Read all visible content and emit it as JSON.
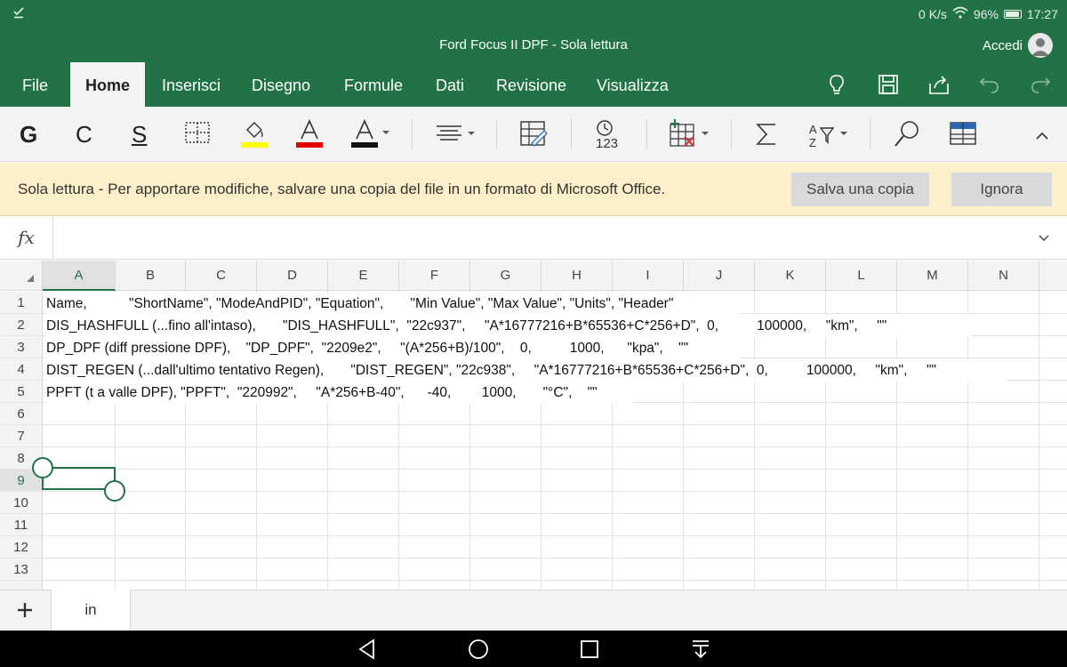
{
  "status_bar": {
    "left_icon": "check-download-icon",
    "network_speed": "0 K/s",
    "battery": "96%",
    "time": "17:27"
  },
  "title_bar": {
    "title": "Ford Focus II DPF - Sola lettura",
    "sign_in": "Accedi"
  },
  "ribbon": {
    "tabs": [
      {
        "label": "File"
      },
      {
        "label": "Home",
        "active": true
      },
      {
        "label": "Inserisci"
      },
      {
        "label": "Disegno"
      },
      {
        "label": "Formule"
      },
      {
        "label": "Dati"
      },
      {
        "label": "Revisione"
      },
      {
        "label": "Visualizza"
      }
    ],
    "tools": {
      "bold": "G",
      "italic": "C",
      "underline": "S",
      "number_format": "123"
    },
    "colors": {
      "accent": "#217346",
      "highlight": "#ffff00",
      "font_color": "#e00000"
    }
  },
  "info_bar": {
    "message": "Sola lettura - Per apportare modifiche, salvare una copia del file in un formato di Microsoft Office.",
    "save_copy": "Salva una copia",
    "ignore": "Ignora"
  },
  "formula_bar": {
    "fx_label": "fx",
    "content": ""
  },
  "sheet": {
    "columns": [
      "A",
      "B",
      "C",
      "D",
      "E",
      "F",
      "G",
      "H",
      "I",
      "J",
      "K",
      "L",
      "M",
      "N"
    ],
    "rows": [
      "1",
      "2",
      "3",
      "4",
      "5",
      "6",
      "7",
      "8",
      "9",
      "10",
      "11",
      "12",
      "13"
    ],
    "cells": [
      "Name,           \"ShortName\", \"ModeAndPID\", \"Equation\",       \"Min Value\", \"Max Value\", \"Units\", \"Header\"",
      "DIS_HASHFULL (...fino all'intaso),       \"DIS_HASHFULL\",  \"22c937\",     \"A*16777216+B*65536+C*256+D\",  0,          100000,     \"km\",     \"\"",
      "DP_DPF (diff pressione DPF),    \"DP_DPF\",  \"2209e2\",     \"(A*256+B)/100\",    0,          1000,      \"kpa\",    \"\"",
      "DIST_REGEN (...dall'ultimo tentativo Regen),       \"DIST_REGEN\", \"22c938\",     \"A*16777216+B*65536+C*256+D\",  0,          100000,     \"km\",     \"\"",
      "PPFT (t a valle DPF), \"PPFT\",  \"220992\",     \"A*256+B-40\",      -40,        1000,       \"°C\",    \"\""
    ],
    "selected_cell": "A9",
    "sheet_tab": "in"
  },
  "nav_bar": {
    "back": "back-icon",
    "home": "home-icon",
    "recents": "recents-icon",
    "notifications": "notification-pull-icon"
  }
}
